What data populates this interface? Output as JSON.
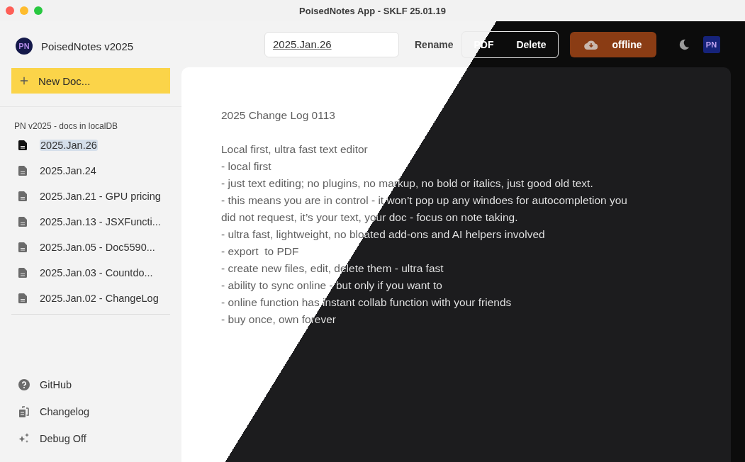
{
  "window": {
    "title": "PoisedNotes App - SKLF 25.01.19"
  },
  "sidebar": {
    "logo": "PN",
    "app_name": "PoisedNotes v2025",
    "new_button": "New Doc...",
    "section_label": "PN v2025 - docs in localDB",
    "docs": [
      {
        "label": "2025.Jan.26",
        "selected": true
      },
      {
        "label": "2025.Jan.24",
        "selected": false
      },
      {
        "label": "2025.Jan.21 - GPU pricing",
        "selected": false
      },
      {
        "label": "2025.Jan.13 - JSXFuncti...",
        "selected": false
      },
      {
        "label": "2025.Jan.05 - Doc5590...",
        "selected": false
      },
      {
        "label": "2025.Jan.03 - Countdo...",
        "selected": false
      },
      {
        "label": "2025.Jan.02 - ChangeLog",
        "selected": false
      }
    ],
    "footer_links": [
      {
        "kind": "help",
        "label": "GitHub"
      },
      {
        "kind": "changelog",
        "label": "Changelog"
      },
      {
        "kind": "sparkle",
        "label": "Debug Off"
      }
    ]
  },
  "toolbar": {
    "title_field": {
      "value": "2025.Jan.26"
    },
    "buttons": [
      "Rename",
      "PDF",
      "Delete"
    ],
    "sync_button": "offline",
    "logo": "PN"
  },
  "editor": {
    "title": "2025 Change Log 0113",
    "lines": [
      "Local first, ultra fast text editor",
      "- local first",
      "- just text editing; no plugins, no markup, no bold or italics, just good old text.",
      "- this means you are in control - it won’t pop up any windoes for autocompletion you",
      "did not request, it’s your text, your doc - focus on note taking.",
      "- ultra fast, lightweight, no bloated add-ons and AI helpers involved",
      "- export  to PDF",
      "- create new files, edit, delete them - ultra fast",
      "- ability to sync online - but only if you want to",
      "- online function has instant collab function with your friends",
      "- buy once, own forever"
    ]
  }
}
